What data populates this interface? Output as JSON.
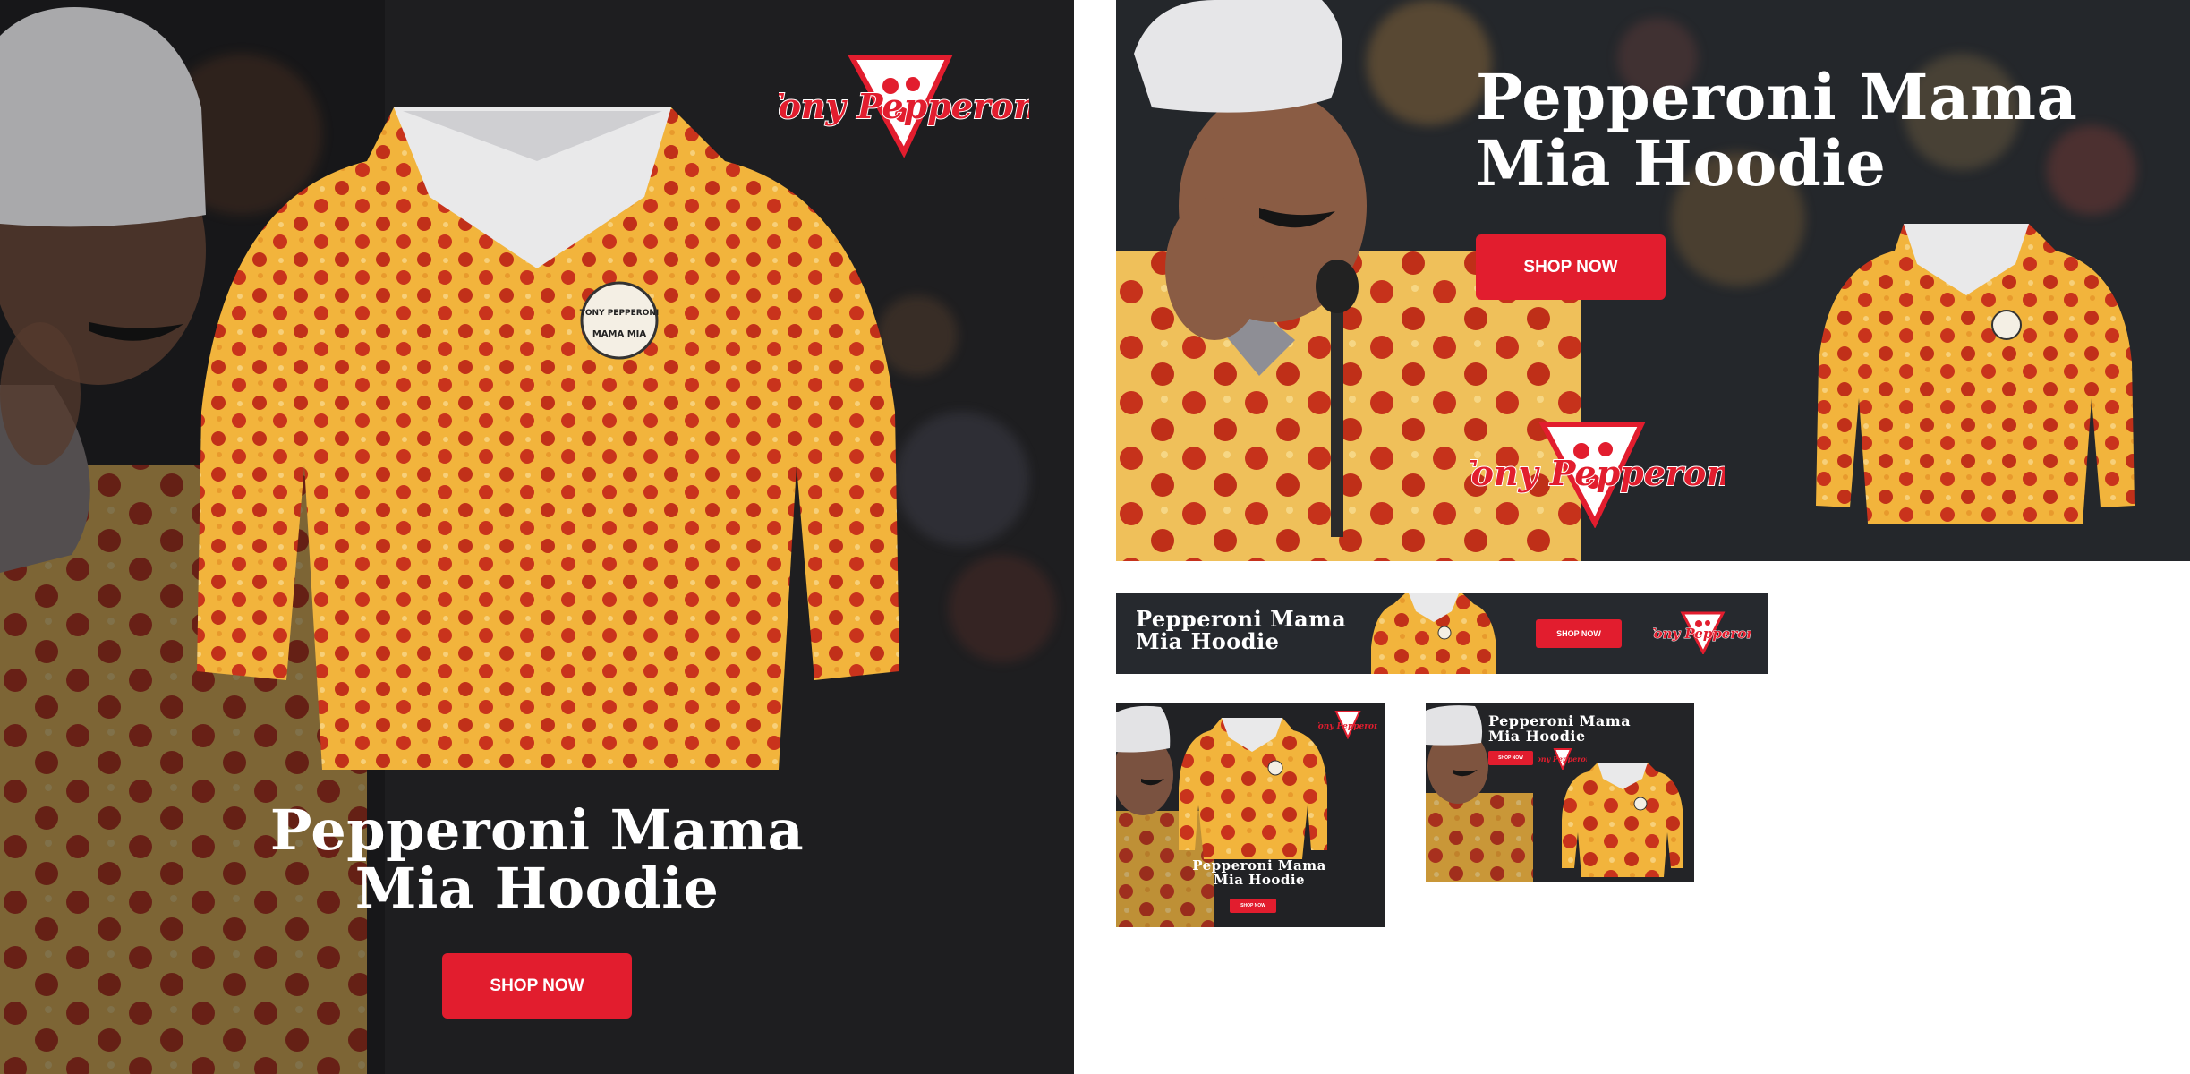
{
  "brand": {
    "name": "Tony Pepperoni",
    "accent": "#e21d2e",
    "background": "#1f1f21"
  },
  "product": {
    "title_line1": "Pepperoni Mama",
    "title_line2": "Mia Hoodie"
  },
  "cta": {
    "label": "SHOP NOW"
  },
  "hoodie_patch": {
    "line1": "TONY PEPPERONI",
    "line2": "MAMA MIA"
  },
  "icons": [
    "pizza-slice-icon",
    "mustache-icon"
  ]
}
